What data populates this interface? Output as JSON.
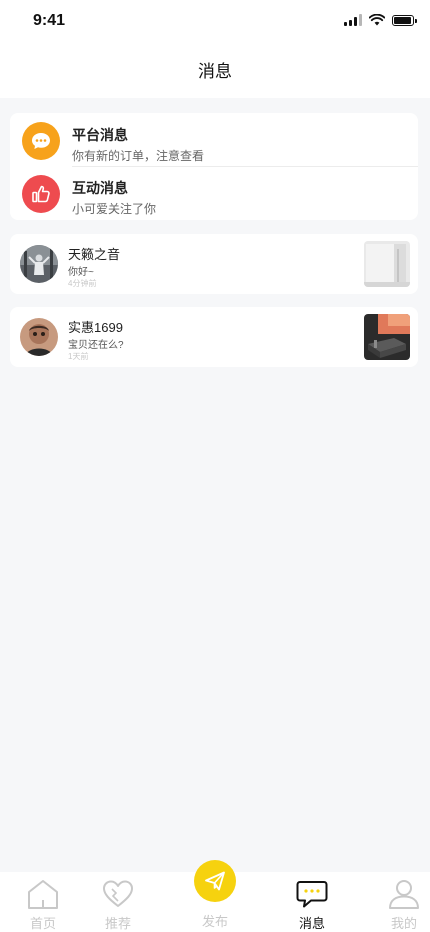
{
  "status_bar": {
    "time": "9:41"
  },
  "header": {
    "title": "消息"
  },
  "system_messages": [
    {
      "title": "平台消息",
      "subtitle": "你有新的订单，注意查看",
      "icon": "chat-bubble-icon",
      "color": "#f7a21b"
    },
    {
      "title": "互动消息",
      "subtitle": "小可爱关注了你",
      "icon": "thumbs-up-icon",
      "color": "#ee4b4f"
    }
  ],
  "conversations": [
    {
      "name": "天籁之音",
      "message": "你好~",
      "time": "4分钟前"
    },
    {
      "name": "实惠1699",
      "message": "宝贝还在么?",
      "time": "1天前"
    }
  ],
  "tab_bar": {
    "items": [
      {
        "label": "首页",
        "icon": "home-icon"
      },
      {
        "label": "推荐",
        "icon": "heart-icon"
      },
      {
        "label": "发布",
        "icon": "paper-plane-icon"
      },
      {
        "label": "消息",
        "icon": "message-icon",
        "active": true
      },
      {
        "label": "我的",
        "icon": "user-icon"
      }
    ]
  },
  "colors": {
    "accent": "#f6d20f",
    "background": "#f6f7f9",
    "inactive_tab": "#c8c8c8"
  }
}
